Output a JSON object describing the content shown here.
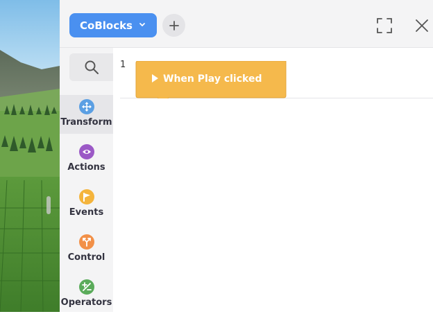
{
  "toolbar": {
    "project_label": "CoBlocks",
    "add_icon": "plus-icon",
    "expand_icon": "fullscreen-icon",
    "close_icon": "close-icon"
  },
  "sidebar": {
    "search_icon": "search-icon",
    "categories": [
      {
        "label": "Transform",
        "icon": "move-arrows-icon",
        "color": "#5b9fe3",
        "active": true
      },
      {
        "label": "Actions",
        "icon": "eye-icon",
        "color": "#9b59c6",
        "active": false
      },
      {
        "label": "Events",
        "icon": "flag-icon",
        "color": "#f4b43c",
        "active": false
      },
      {
        "label": "Control",
        "icon": "branch-icon",
        "color": "#f29048",
        "active": false
      },
      {
        "label": "Operators",
        "icon": "plus-minus-icon",
        "color": "#5aab5a",
        "active": false
      }
    ]
  },
  "workspace": {
    "line_number": "1",
    "block_label": "When Play clicked",
    "block_color": "#f5b94c"
  },
  "colors": {
    "accent": "#4a90f0",
    "panel_bg": "#f4f4f5"
  }
}
